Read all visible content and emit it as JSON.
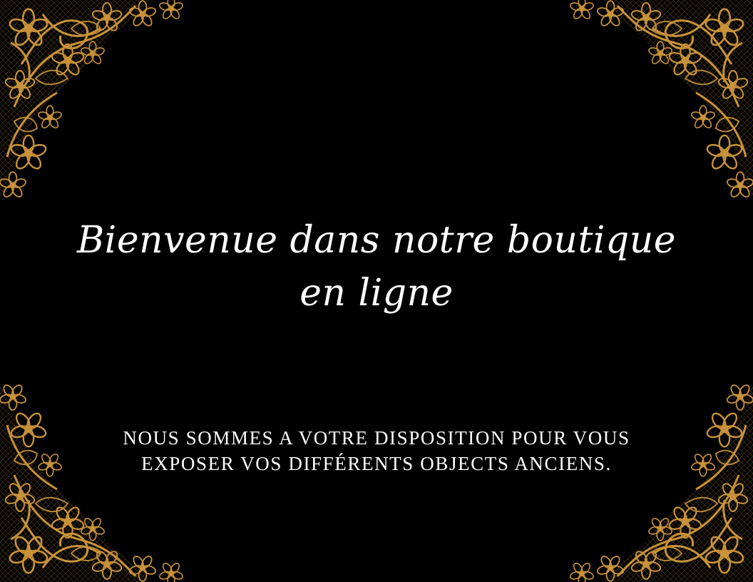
{
  "colors": {
    "background": "#000000",
    "lace_gold": "#C8923A",
    "text": "#FFFFFF"
  },
  "decoration": {
    "corner_icon": "gold-lace-floral-corner-icon"
  },
  "title": {
    "line1": "Bienvenue dans notre boutique",
    "line2": "en ligne"
  },
  "subtitle": {
    "line1": "NOUS SOMMES A VOTRE DISPOSITION POUR VOUS",
    "line2": "EXPOSER VOS DIFFÉRENTS OBJECTS ANCIENS."
  }
}
